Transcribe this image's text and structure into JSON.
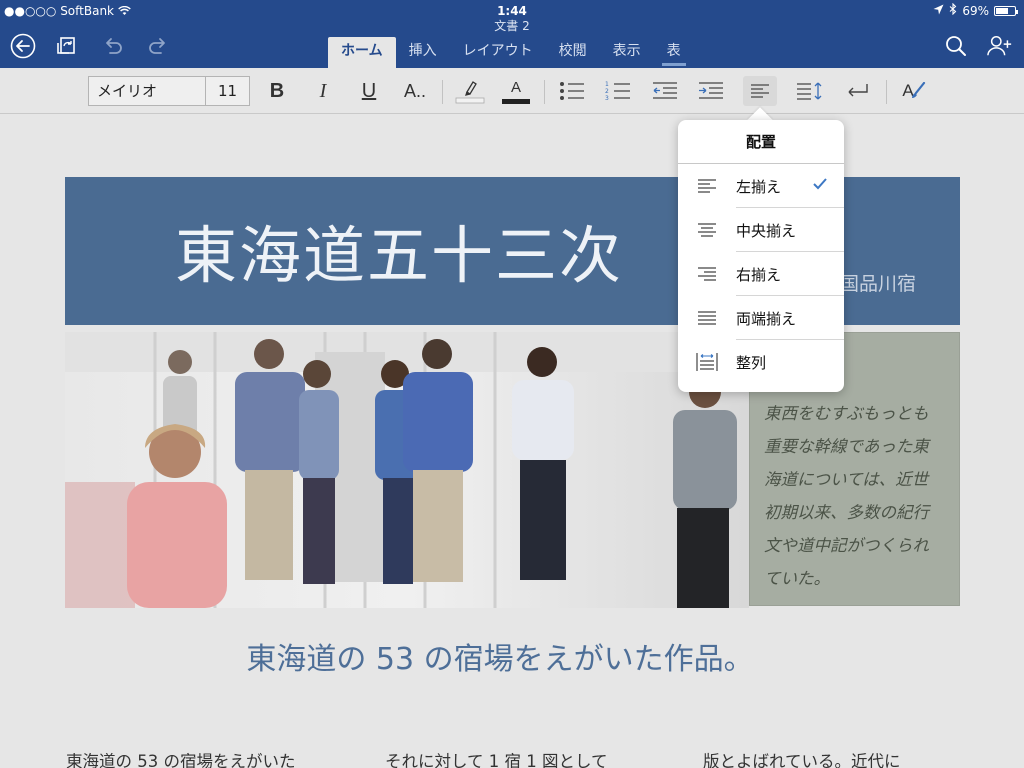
{
  "status": {
    "signal_text": "●●○○○",
    "carrier": "SoftBank",
    "time": "1:44",
    "battery_text": "69%",
    "battery_level": 0.69
  },
  "document_title": "文書 2",
  "icons": {
    "back": "back-arrow-circle-icon",
    "sync": "sync-document-icon",
    "undo": "undo-icon",
    "redo": "redo-icon",
    "search": "search-icon",
    "share": "add-person-icon",
    "location": "location-arrow-icon",
    "bluetooth": "bluetooth-icon",
    "wifi": "wifi-icon"
  },
  "tabs": [
    {
      "label": "ホーム",
      "active": true
    },
    {
      "label": "挿入"
    },
    {
      "label": "レイアウト"
    },
    {
      "label": "校閲"
    },
    {
      "label": "表示"
    },
    {
      "label": "表"
    }
  ],
  "ribbon": {
    "font_name": "メイリオ",
    "font_size": "11",
    "bold": "B",
    "italic": "I",
    "underline": "U",
    "more_format": "A..",
    "font_color_letter": "A",
    "style_letter": "A"
  },
  "colors": {
    "title_bar": "#254a8c",
    "highlight_color": "#f2f2f2",
    "font_color": "#222222",
    "check": "#3d78c4"
  },
  "popover": {
    "title": "配置",
    "items": [
      {
        "label": "左揃え",
        "checked": true,
        "icon": "align-left-icon"
      },
      {
        "label": "中央揃え",
        "icon": "align-center-icon"
      },
      {
        "label": "右揃え",
        "icon": "align-right-icon"
      },
      {
        "label": "両端揃え",
        "icon": "align-justify-icon"
      },
      {
        "label": "整列",
        "icon": "distributed-icon"
      }
    ]
  },
  "document": {
    "banner_title": "東海道五十三次",
    "banner_subtitle": "国品川宿",
    "sidebar_lines": [
      "東西をむすぶもっとも",
      "重要な幹線であった東",
      "海道については、近世",
      "初期以来、多数の紀行",
      "文や道中記がつくられ",
      "ていた。"
    ],
    "subheading": "東海道の 53 の宿場をえがいた作品。",
    "columns": [
      "東海道の 53 の宿場をえがいた",
      "それに対して 1 宿 1 図として",
      "版とよばれている。近代に"
    ]
  }
}
